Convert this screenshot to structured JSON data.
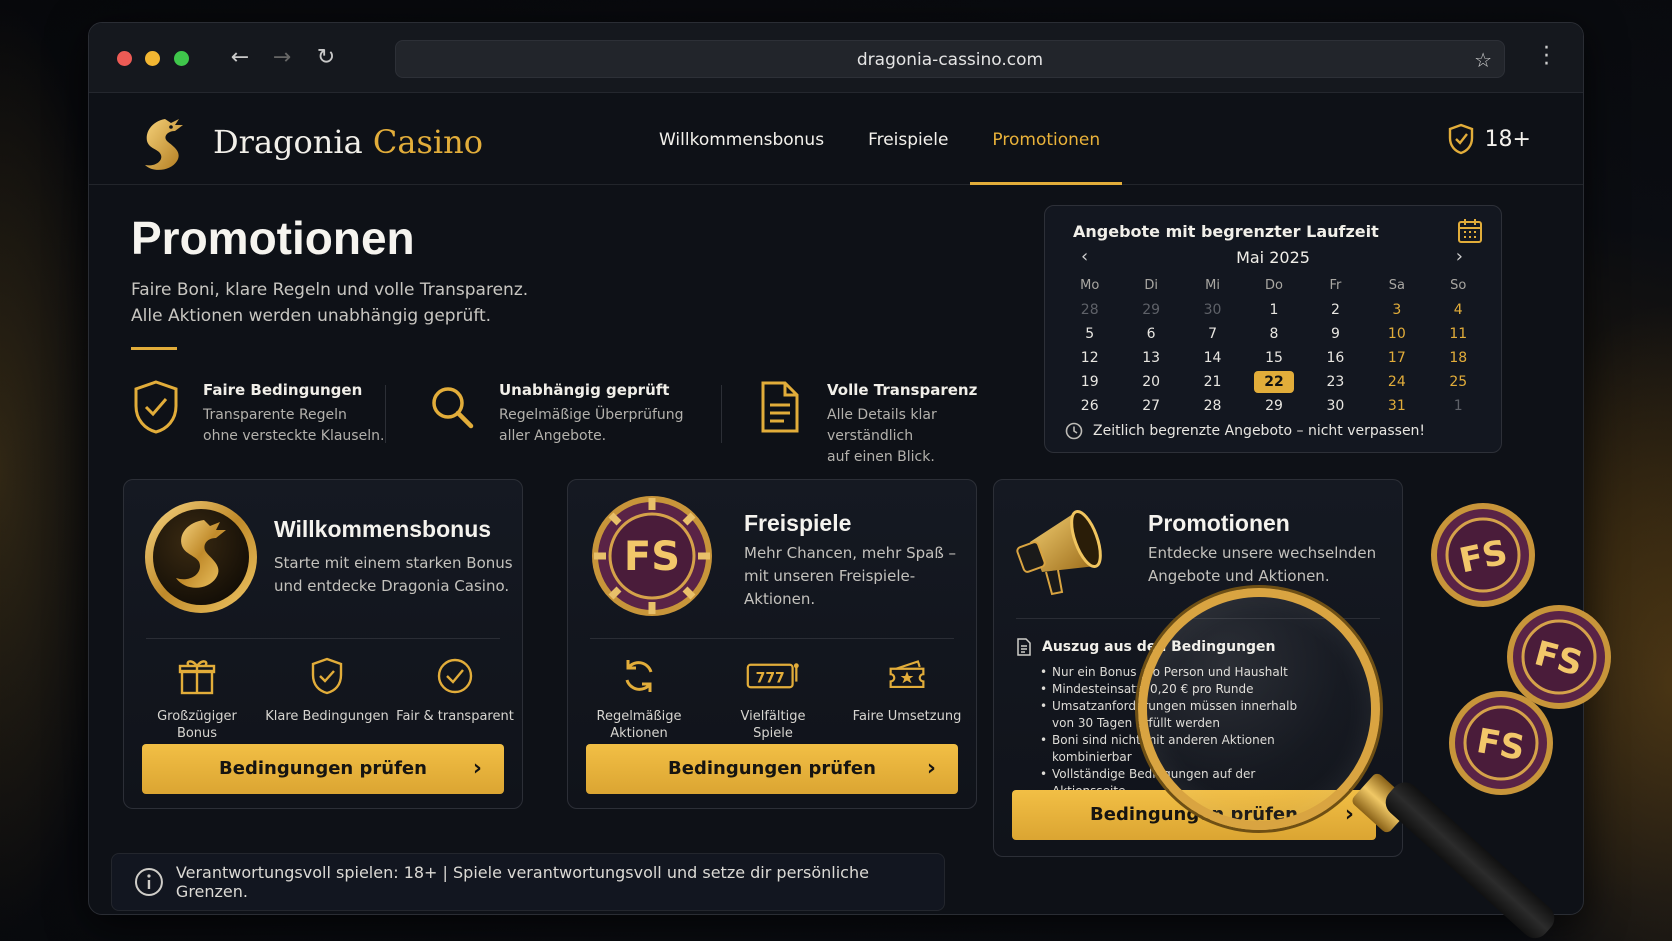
{
  "browser": {
    "url": "dragonia-cassino.com"
  },
  "header": {
    "brand_main": "Dragonia",
    "brand_accent": "Casino",
    "nav": [
      "Willkommensbonus",
      "Freispiele",
      "Promotionen"
    ],
    "active_nav": "Promotionen",
    "age_label": "18+"
  },
  "hero": {
    "title": "Promotionen",
    "subtitle_line1": "Faire Boni, klare Regeln und volle Transparenz.",
    "subtitle_line2": "Alle Aktionen werden unabhängig geprüft."
  },
  "features": [
    {
      "title": "Faire Bedingungen",
      "desc_line1": "Transparente Regeln",
      "desc_line2": "ohne versteckte Klauseln.",
      "icon": "shield-check-icon"
    },
    {
      "title": "Unabhängig geprüft",
      "desc_line1": "Regelmäßige Überprüfung",
      "desc_line2": "aller Angebote.",
      "icon": "search-icon"
    },
    {
      "title": "Volle Transparenz",
      "desc_line1": "Alle Details klar verständlich",
      "desc_line2": "auf einen Blick.",
      "icon": "document-icon"
    }
  ],
  "calendar": {
    "title": "Angebote mit begrenzter Laufzeit",
    "month": "Mai 2025",
    "weekdays": [
      "Mo",
      "Di",
      "Mi",
      "Do",
      "Fr",
      "Sa",
      "So"
    ],
    "weeks": [
      [
        "28",
        "29",
        "30",
        "1",
        "2",
        "3",
        "4"
      ],
      [
        "5",
        "6",
        "7",
        "8",
        "9",
        "10",
        "11"
      ],
      [
        "12",
        "13",
        "14",
        "15",
        "16",
        "17",
        "18"
      ],
      [
        "19",
        "20",
        "21",
        "22",
        "23",
        "24",
        "25"
      ],
      [
        "26",
        "27",
        "28",
        "29",
        "30",
        "31",
        "1"
      ]
    ],
    "highlighted_day": "22",
    "footer": "Zeitlich begrenzte Angeboto – nicht verpassen!"
  },
  "cards": {
    "welcome": {
      "title": "Willkommensbonus",
      "desc_line1": "Starte mit einem starken Bonus",
      "desc_line2": "und entdecke Dragonia Casino.",
      "perks": [
        {
          "line1": "Großzügiger",
          "line2": "Bonus",
          "icon": "gift-icon"
        },
        {
          "line1": "Klare Bedingungen",
          "line2": "",
          "icon": "shield-check-icon"
        },
        {
          "line1": "Fair & transparent",
          "line2": "",
          "icon": "check-circle-icon"
        }
      ],
      "cta": "Bedingungen prüfen"
    },
    "freespins": {
      "title": "Freispiele",
      "desc_line1": "Mehr Chancen, mehr Spaß –",
      "desc_line2": "mit unseren Freispiele-",
      "desc_line3": "Aktionen.",
      "chip_label": "FS",
      "perks": [
        {
          "line1": "Regelmäßige",
          "line2": "Aktionen",
          "icon": "refresh-icon"
        },
        {
          "line1": "Vielfältige",
          "line2": "Spiele",
          "icon": "slot-777-icon"
        },
        {
          "line1": "Faire Umsetzung",
          "line2": "",
          "icon": "ticket-star-icon"
        }
      ],
      "cta": "Bedingungen prüfen"
    },
    "promos": {
      "title": "Promotionen",
      "desc_line1": "Entdecke unsere wechselnden",
      "desc_line2": "Angebote und Aktionen.",
      "terms_title": "Auszug aus den Bedingungen",
      "terms": [
        "Nur ein Bonus pro Person und Haushalt",
        "Mindesteinsatz: 0,20 € pro Runde",
        "Umsatzanforderungen müssen innerhalb von 30 Tagen erfüllt werden",
        "Boni sind nicht mit anderen Aktionen kombinierbar",
        "Vollständige Bedingungen auf der Aktionsseite"
      ],
      "cta": "Bedingungen prüfen"
    }
  },
  "footer": {
    "text": "Verantwortungsvoll spielen: 18+ | Spiele verantwortungsvoll und setze dir persönliche Grenzen."
  },
  "decor": {
    "chip_label": "FS"
  },
  "colors": {
    "accent": "#e2ad3a",
    "background": "#0e1117",
    "chip_purple": "#5a2346"
  }
}
